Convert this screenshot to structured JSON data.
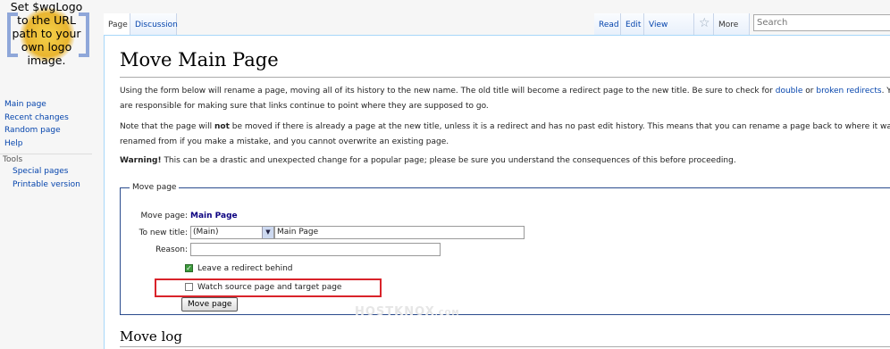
{
  "logo": {
    "text_lines": [
      "Set $wgLogo",
      "to the URL",
      "path to your",
      "own logo",
      "image."
    ]
  },
  "sidebar": {
    "nav": [
      {
        "label": "Main page"
      },
      {
        "label": "Recent changes"
      },
      {
        "label": "Random page"
      },
      {
        "label": "Help"
      }
    ],
    "tools_label": "Tools",
    "tools": [
      {
        "label": "Special pages"
      },
      {
        "label": "Printable version"
      }
    ]
  },
  "tabs": {
    "page": "Page",
    "discussion": "Discussion",
    "read": "Read",
    "edit": "Edit",
    "history": "View history",
    "watch_icon": "star-icon",
    "more": "More"
  },
  "search": {
    "placeholder": "Search"
  },
  "content": {
    "title": "Move Main Page",
    "p1": {
      "before": "Using the form below will rename a page, moving all of its history to the new name. The old title will become a redirect page to the new title. Be sure to check for ",
      "link1": "double",
      "mid": " or ",
      "link2": "broken redirects",
      "after": ". You are responsible for making sure that links continue to point where they are supposed to go."
    },
    "p2": {
      "before": "Note that the page will ",
      "bold": "not",
      "after": " be moved if there is already a page at the new title, unless it is a redirect and has no past edit history. This means that you can rename a page back to where it was renamed from if you make a mistake, and you cannot overwrite an existing page."
    },
    "p3": {
      "bold": "Warning!",
      "after": " This can be a drastic and unexpected change for a popular page; please be sure you understand the consequences of this before proceeding."
    },
    "form": {
      "legend": "Move page",
      "move_page_label": "Move page:",
      "move_page_value": "Main Page",
      "new_title_label": "To new title:",
      "namespace": "(Main)",
      "new_title_value": "Main Page",
      "reason_label": "Reason:",
      "reason_value": "",
      "leave_redirect_label": "Leave a redirect behind",
      "leave_redirect_checked": true,
      "watch_label": "Watch source page and target page",
      "watch_checked": false,
      "submit": "Move page"
    },
    "watermark": {
      "main": "HOSTKNOX",
      "suffix": ".COM"
    },
    "move_log_title": "Move log"
  },
  "colors": {
    "link": "#0645ad",
    "highlight": "#d9232a"
  }
}
